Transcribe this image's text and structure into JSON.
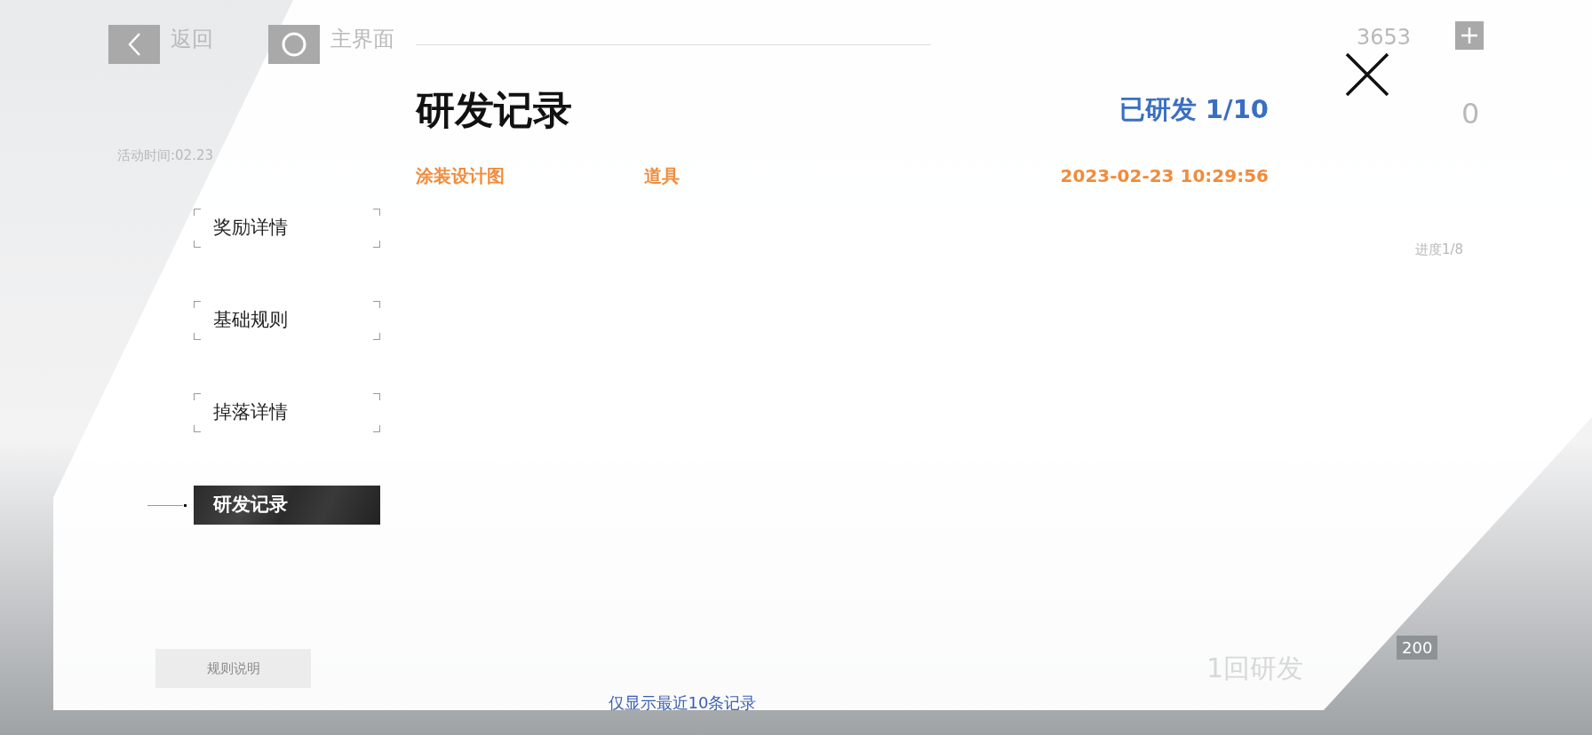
{
  "background": {
    "back_label": "返回",
    "home_label": "主界面",
    "event_time": "活动时间:02.23",
    "currency": "3653",
    "ticket_count": "0",
    "progress": "进度1/8",
    "rules_button": "规则说明",
    "research_button": "1回研发",
    "research_cost": "200"
  },
  "modal": {
    "title": "研发记录",
    "count": "已研发 1/10",
    "tabs": [
      {
        "label": "奖励详情",
        "selected": false
      },
      {
        "label": "基础规则",
        "selected": false
      },
      {
        "label": "掉落详情",
        "selected": false
      },
      {
        "label": "研发记录",
        "selected": true
      }
    ],
    "records": [
      {
        "name": "涂装设计图",
        "type": "道具",
        "time": "2023-02-23 10:29:56"
      }
    ],
    "footer_note": "仅显示最近10条记录"
  }
}
